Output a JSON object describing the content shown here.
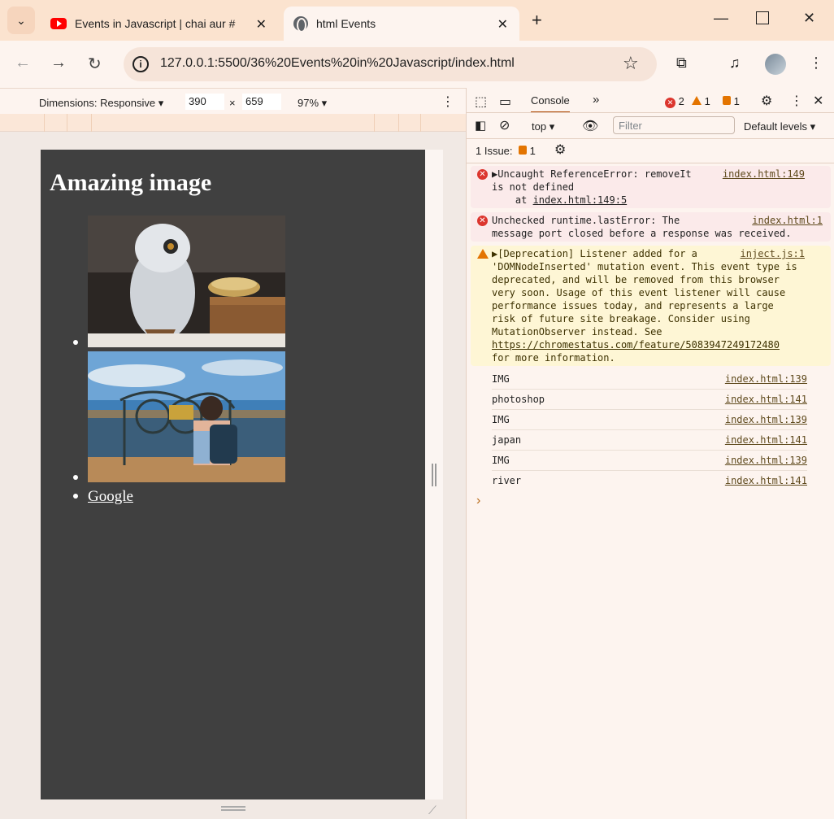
{
  "browser": {
    "tabs": [
      {
        "title": "Events in Javascript | chai aur #",
        "icon": "youtube-icon",
        "active": false
      },
      {
        "title": "html Events",
        "icon": "globe-icon",
        "active": true
      }
    ],
    "url": "127.0.0.1:5500/36%20Events%20in%20Javascript/index.html"
  },
  "device_toolbar": {
    "dimensions_label": "Dimensions: Responsive",
    "width": "390",
    "times": "×",
    "height": "659",
    "zoom": "97%"
  },
  "page": {
    "heading": "Amazing image",
    "images": [
      {
        "alt": "owl",
        "description": "white owl figurine"
      },
      {
        "alt": "river",
        "description": "woman at bridge railing"
      }
    ],
    "link_text": "Google"
  },
  "devtools": {
    "tab_console": "Console",
    "error_count": "2",
    "warning_count": "1",
    "issue_count": "1",
    "context": "top",
    "filter_placeholder": "Filter",
    "levels": "Default levels",
    "issues_label": "1 Issue:",
    "issues_num": "1",
    "messages": [
      {
        "type": "error",
        "text": "▶Uncaught ReferenceError: removeIt\nis not defined\n    at ",
        "link": "index.html:149:5",
        "source": "index.html:149"
      },
      {
        "type": "error",
        "text": "Unchecked runtime.lastError: The\nmessage port closed before a response was received.",
        "source": "index.html:1"
      },
      {
        "type": "warning",
        "text": "▶[Deprecation] Listener added for a\n'DOMNodeInserted' mutation event. This event type is\ndeprecated, and will be removed from this browser\nvery soon. Usage of this event listener will cause\nperformance issues today, and represents a large\nrisk of future site breakage. Consider using\nMutationObserver instead. See",
        "link": "https://chromestatus.com/feature/5083947249172480",
        "tail": "for more information.",
        "source": "inject.js:1"
      }
    ],
    "logs": [
      {
        "text": "IMG",
        "source": "index.html:139"
      },
      {
        "text": "photoshop",
        "source": "index.html:141"
      },
      {
        "text": "IMG",
        "source": "index.html:139"
      },
      {
        "text": "japan",
        "source": "index.html:141"
      },
      {
        "text": "IMG",
        "source": "index.html:139"
      },
      {
        "text": "river",
        "source": "index.html:141"
      }
    ],
    "prompt": "›"
  },
  "colors": {
    "titlebar": "#fbe3cf",
    "page_bg": "#404040",
    "error_bg": "#fbeaea",
    "warning_bg": "#fef6d5",
    "error_red": "#dc362e",
    "warning_orange": "#e37400"
  }
}
